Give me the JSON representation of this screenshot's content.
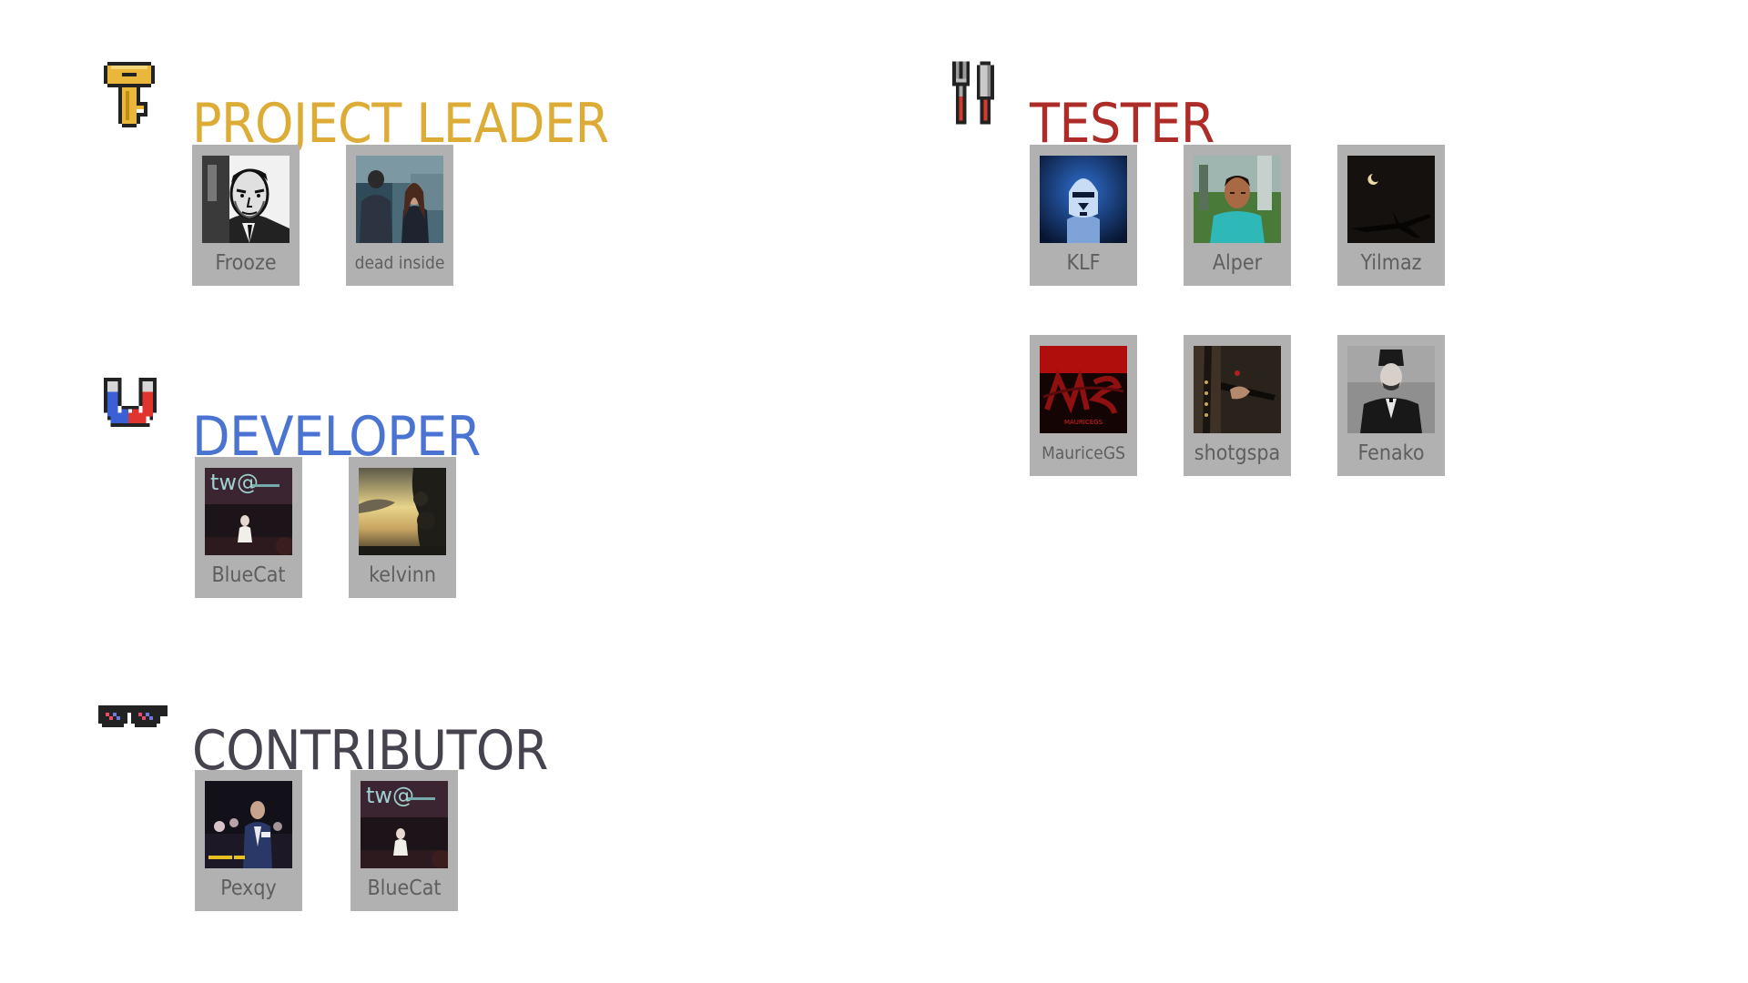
{
  "colors": {
    "project_leader": "#dcac36",
    "developer": "#4a73d2",
    "contributor": "#47434e",
    "tester": "#ad2c27",
    "card_bg": "#b1b1b1",
    "name_text": "#5e5e5e"
  },
  "sections": {
    "project_leader": {
      "title": "PROJECT LEADER",
      "icon": "key-icon",
      "members": [
        {
          "name": "Frooze",
          "avatar": "noir-man-avatar"
        },
        {
          "name": "dead inside",
          "avatar": "office-scene-avatar"
        }
      ]
    },
    "developer": {
      "title": "DEVELOPER",
      "icon": "magnet-icon",
      "members": [
        {
          "name": "BlueCat",
          "avatar": "stage-tw-avatar"
        },
        {
          "name": "kelvinn",
          "avatar": "sunset-sky-avatar"
        }
      ]
    },
    "contributor": {
      "title": "CONTRIBUTOR",
      "icon": "pixel-sunglasses-icon",
      "members": [
        {
          "name": "Pexqy",
          "avatar": "crowd-avatar"
        },
        {
          "name": "BlueCat",
          "avatar": "stage-tw-avatar"
        }
      ]
    },
    "tester": {
      "title": "TESTER",
      "icon": "fork-knife-icon",
      "members": [
        {
          "name": "KLF",
          "avatar": "trooper-avatar"
        },
        {
          "name": "Alper",
          "avatar": "game-character-avatar"
        },
        {
          "name": "Yilmaz",
          "avatar": "night-plane-avatar"
        },
        {
          "name": "MauriceGS",
          "avatar": "red-logo-avatar"
        },
        {
          "name": "shotgspa",
          "avatar": "gun-closeup-avatar"
        },
        {
          "name": "Fenako",
          "avatar": "vintage-portrait-avatar"
        }
      ]
    }
  }
}
